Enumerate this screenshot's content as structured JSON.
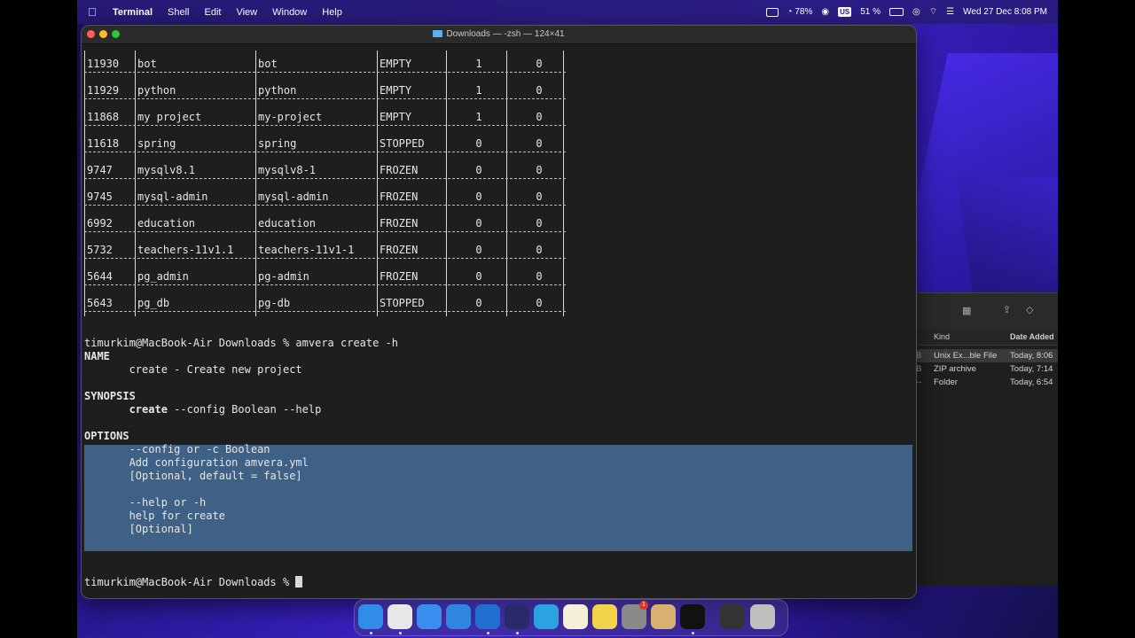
{
  "menubar": {
    "app_name": "Terminal",
    "items": [
      "Shell",
      "Edit",
      "View",
      "Window",
      "Help"
    ],
    "battery_percent_circle": "78%",
    "keyboard": "US",
    "battery_percent": "51 %",
    "datetime": "Wed 27 Dec  8:08 PM"
  },
  "terminal": {
    "title": "Downloads — -zsh — 124×41",
    "table_rows": [
      [
        "11930",
        "bot",
        "bot",
        "EMPTY",
        "1",
        "0"
      ],
      [
        "11929",
        "python",
        "python",
        "EMPTY",
        "1",
        "0"
      ],
      [
        "11868",
        "my project",
        "my-project",
        "EMPTY",
        "1",
        "0"
      ],
      [
        "11618",
        "spring",
        "spring",
        "STOPPED",
        "0",
        "0"
      ],
      [
        "9747",
        "mysqlv8.1",
        "mysqlv8-1",
        "FROZEN",
        "0",
        "0"
      ],
      [
        "9745",
        "mysql-admin",
        "mysql-admin",
        "FROZEN",
        "0",
        "0"
      ],
      [
        "6992",
        "education",
        "education",
        "FROZEN",
        "0",
        "0"
      ],
      [
        "5732",
        "teachers-11v1.1",
        "teachers-11v1-1",
        "FROZEN",
        "0",
        "0"
      ],
      [
        "5644",
        "pg_admin",
        "pg-admin",
        "FROZEN",
        "0",
        "0"
      ],
      [
        "5643",
        "pg_db",
        "pg-db",
        "STOPPED",
        "0",
        "0"
      ]
    ],
    "prompt": "timurkim@MacBook-Air Downloads %",
    "command": "amvera create -h",
    "help": {
      "name_header": "NAME",
      "name_line": "       create - Create new project",
      "synopsis_header": "SYNOPSIS",
      "synopsis_cmd": "       create",
      "synopsis_args": " --config Boolean --help",
      "options_header": "OPTIONS",
      "opt1_name": "       --config or -c Boolean",
      "opt1_desc": "       Add configuration amvera.yml",
      "opt1_default": "       [Optional, default = false]",
      "opt2_name": "       --help or -h",
      "opt2_desc": "       help for create",
      "opt2_default": "       [Optional]"
    }
  },
  "finder": {
    "col_kind": "Kind",
    "col_date": "Date Added",
    "rows": [
      {
        "size": "B",
        "kind": "Unix Ex...ble File",
        "date": "Today, 8:06"
      },
      {
        "size": "B",
        "kind": "ZIP archive",
        "date": "Today, 7:14"
      },
      {
        "size": "--",
        "kind": "Folder",
        "date": "Today, 6:54"
      }
    ]
  },
  "dock": {
    "apps": [
      "finder-icon",
      "chrome-icon",
      "mail-icon",
      "safari-icon",
      "vscode-icon",
      "intellij-icon",
      "telegram-icon",
      "notes-icon",
      "stickies-icon",
      "settings-icon",
      "recycle-icon",
      "terminal-icon",
      "screen-icon",
      "trash-icon"
    ],
    "badge_count": "1",
    "colors": {
      "finder": "#2f8ce8",
      "chrome": "#e8e8e8",
      "mail": "#3a8ef0",
      "safari": "#2f86e0",
      "vscode": "#1e6fd0",
      "intellij": "#2a2a6a",
      "telegram": "#2aa3e0",
      "notes": "#f5f1d8",
      "stickies": "#f3d34a",
      "settings": "#8a8a8a",
      "recycle": "#d8b070",
      "terminal": "#111111",
      "screen": "#333333",
      "trash": "#bfbfbf"
    }
  }
}
